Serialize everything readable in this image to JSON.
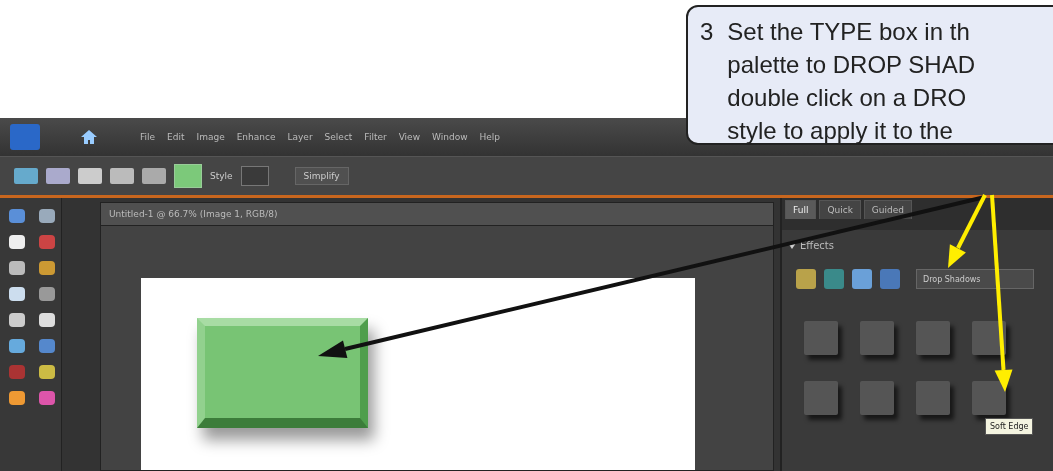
{
  "callout": {
    "number": "3",
    "text": "Set the TYPE box in th\npalette to DROP SHAD\ndouble click on a DRO\nstyle to apply it to the"
  },
  "menu": [
    "File",
    "Edit",
    "Image",
    "Enhance",
    "Layer",
    "Select",
    "Filter",
    "View",
    "Window",
    "Help"
  ],
  "options_bar": {
    "style_label": "Style",
    "simplify_button": "Simplify"
  },
  "document": {
    "title": "Untitled-1 @ 66.7% (Image 1, RGB/8)"
  },
  "panel": {
    "tabs": [
      {
        "label": "Full",
        "selected": true
      },
      {
        "label": "Quick",
        "selected": false
      },
      {
        "label": "Guided",
        "selected": false
      }
    ],
    "section": {
      "title": "Effects",
      "expanded": true
    },
    "type_dropdown": "Drop Shadows",
    "tooltip": "Soft Edge"
  }
}
